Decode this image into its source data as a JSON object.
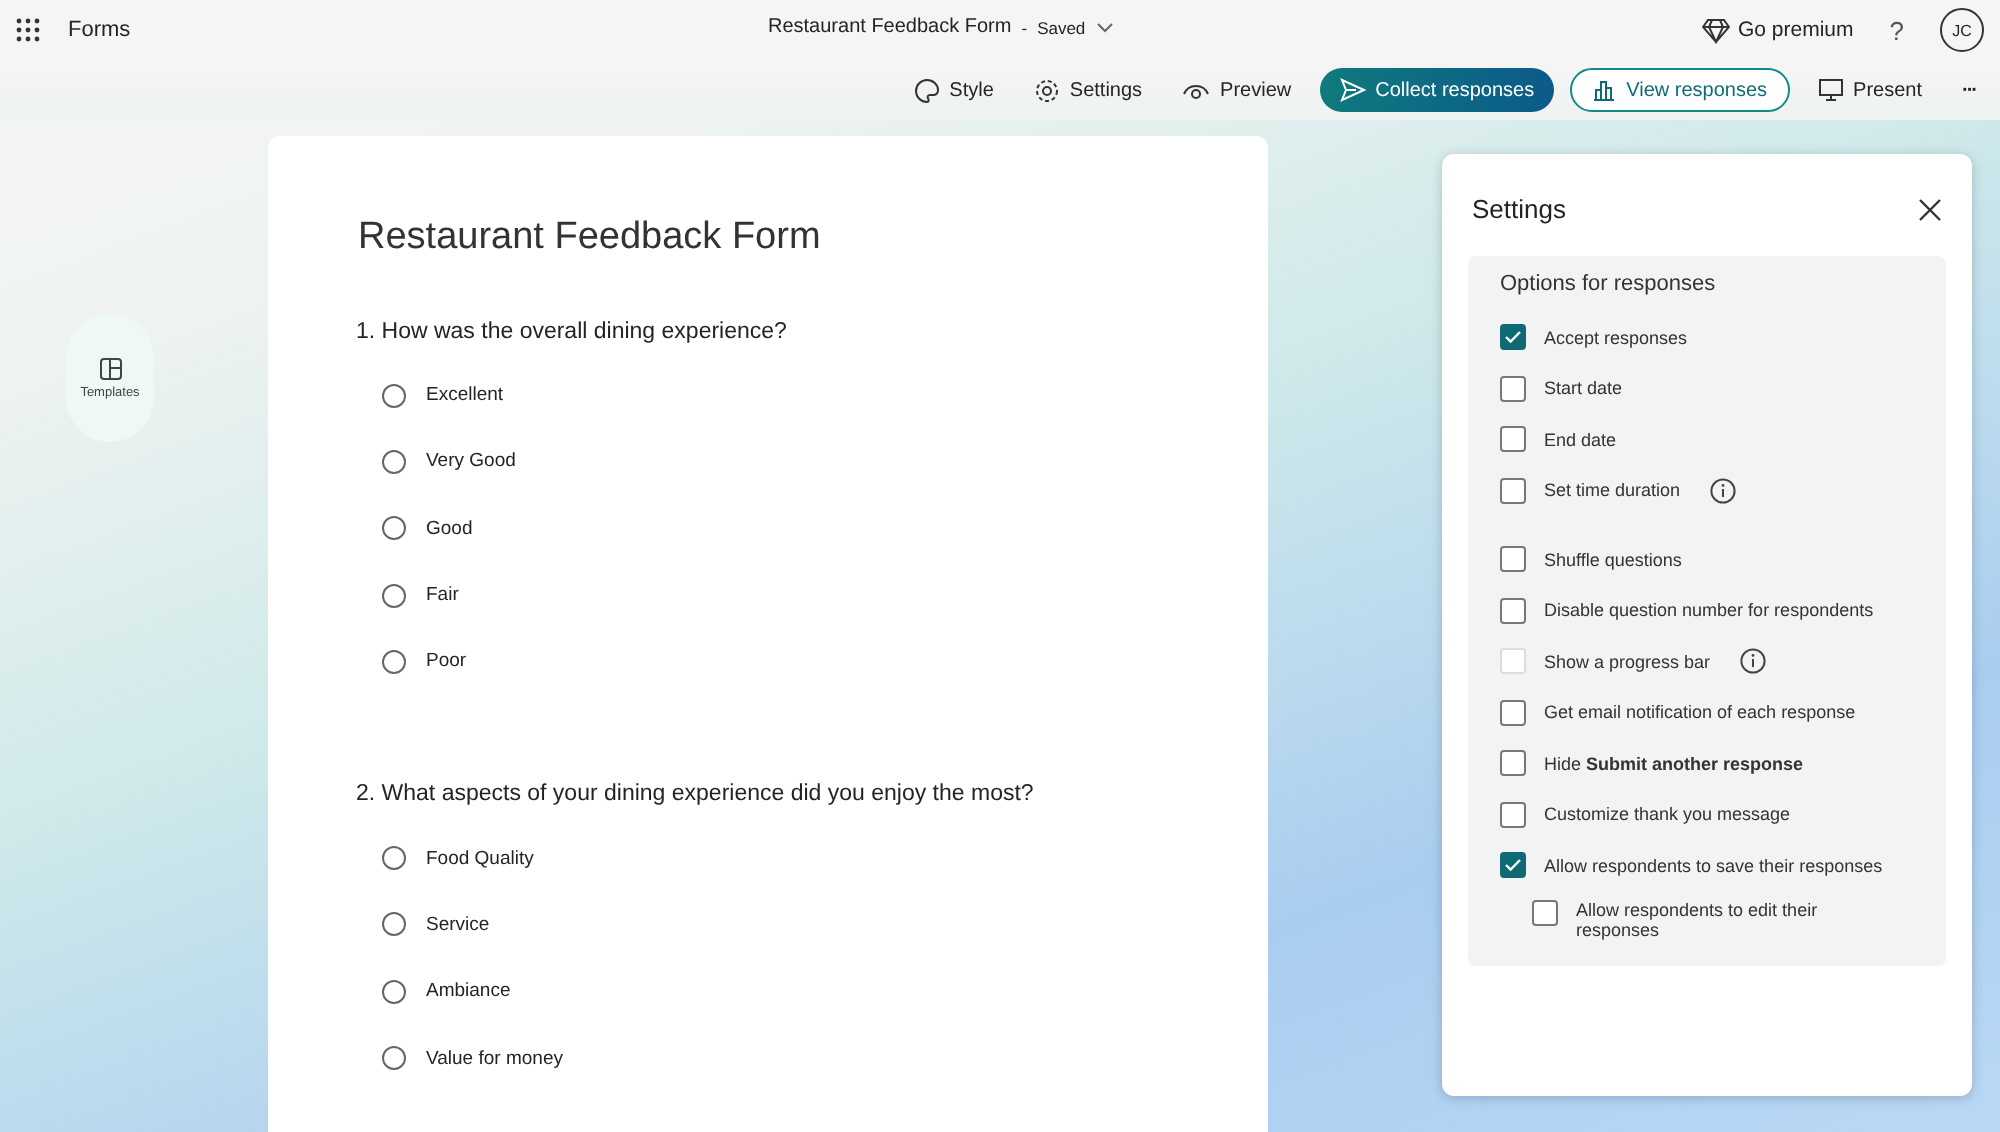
{
  "app": {
    "name": "Forms"
  },
  "document": {
    "title": "Restaurant Feedback Form",
    "separator": "-",
    "status": "Saved"
  },
  "header_actions": {
    "premium": "Go premium",
    "help": "?",
    "avatar": "JC"
  },
  "toolbar": [
    {
      "label": "Style",
      "kind": "plain"
    },
    {
      "label": "Settings",
      "kind": "plain"
    },
    {
      "label": "Preview",
      "kind": "plain"
    },
    {
      "label": "Collect responses",
      "kind": "primary"
    },
    {
      "label": "View responses",
      "kind": "outline"
    },
    {
      "label": "Present",
      "kind": "plain"
    },
    {
      "label": "···",
      "kind": "more"
    }
  ],
  "side_button": {
    "label": "Templates"
  },
  "form": {
    "title": "Restaurant Feedback Form",
    "questions": [
      {
        "title": "1. How was the overall dining experience?",
        "options": [
          {
            "label": "Excellent",
            "selected": false
          },
          {
            "label": "Very Good",
            "selected": false
          },
          {
            "label": "Good",
            "selected": false
          },
          {
            "label": "Fair",
            "selected": false
          },
          {
            "label": "Poor",
            "selected": false
          }
        ]
      },
      {
        "title": "2. What aspects of your dining experience did you enjoy the most?",
        "options": [
          {
            "label": "Food Quality",
            "selected": false
          },
          {
            "label": "Service",
            "selected": false
          },
          {
            "label": "Ambiance",
            "selected": false
          },
          {
            "label": "Value for money",
            "selected": false
          }
        ]
      }
    ]
  },
  "settings": {
    "title": "Settings",
    "section": "Options for responses",
    "options": [
      {
        "label": "Accept responses",
        "checked": true,
        "disabled": false,
        "info": false
      },
      {
        "label": "Start date",
        "checked": false,
        "disabled": false,
        "info": false
      },
      {
        "label": "End date",
        "checked": false,
        "disabled": false,
        "info": false
      },
      {
        "label": "Set time duration",
        "checked": false,
        "disabled": false,
        "info": true
      },
      {
        "label": "Shuffle questions",
        "checked": false,
        "disabled": false,
        "info": false
      },
      {
        "label": "Disable question number for respondents",
        "checked": false,
        "disabled": false,
        "info": false
      },
      {
        "label": "Show a progress bar",
        "checked": false,
        "disabled": true,
        "info": true
      },
      {
        "label": "Get email notification of each response",
        "checked": false,
        "disabled": false,
        "info": false
      },
      {
        "label": "Hide **Submit another response**",
        "checked": false,
        "disabled": false,
        "info": false
      },
      {
        "label": "Customize thank you message",
        "checked": false,
        "disabled": false,
        "info": false
      },
      {
        "label": "Allow respondents to save their responses",
        "checked": true,
        "disabled": false,
        "info": false,
        "children": [
          {
            "label": "Allow respondents to edit their responses",
            "checked": false,
            "disabled": false,
            "info": false
          }
        ]
      }
    ]
  }
}
